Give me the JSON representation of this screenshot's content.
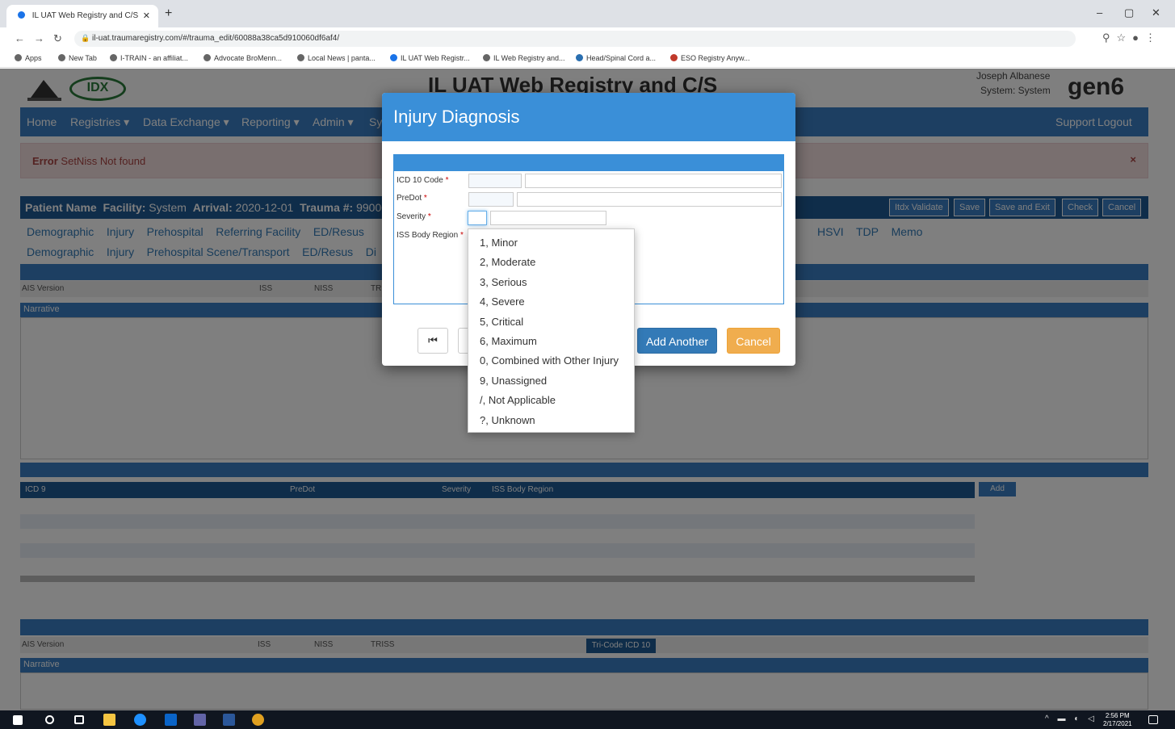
{
  "browser": {
    "tab_title": "IL UAT Web Registry and C/S",
    "url": "il-uat.traumaregistry.com/#/trauma_edit/60088a38ca5d910060df6af4/",
    "bookmarks": [
      "Apps",
      "New Tab",
      "I-TRAIN - an affiliat...",
      "Advocate BroMenn...",
      "Local News | panta...",
      "IL UAT Web Registr...",
      "IL Web Registry and...",
      "Head/Spinal Cord a...",
      "ESO Registry Anyw..."
    ]
  },
  "app": {
    "title": "IL UAT Web Registry and C/S",
    "user_name": "Joseph Albanese",
    "user_system": "System: System",
    "brand": "gen6",
    "logo_text": "IDX",
    "nav": [
      "Home",
      "Registries ▾",
      "Data Exchange ▾",
      "Reporting ▾",
      "Admin ▾",
      "Sy"
    ],
    "nav_right": [
      "Support",
      "Logout"
    ],
    "error_label": "Error",
    "error_text": "SetNiss Not found",
    "error_close": "×",
    "patient_bar": {
      "name_label": "Patient Name",
      "facility_label": "Facility:",
      "facility_value": "System",
      "arrival_label": "Arrival:",
      "arrival_value": "2020-12-01",
      "trauma_label": "Trauma #:",
      "trauma_value": "99000"
    },
    "toolbar_buttons": [
      "Itdx Validate",
      "Save",
      "Save and Exit",
      "Check",
      "Cancel"
    ],
    "link_row1": [
      "Demographic",
      "Injury",
      "Prehospital",
      "Referring Facility",
      "ED/Resus"
    ],
    "link_row1_right": [
      "HSVI",
      "TDP",
      "Memo"
    ],
    "link_row2": [
      "Demographic",
      "Injury",
      "Prehospital Scene/Transport",
      "ED/Resus",
      "Di"
    ],
    "ais_fields": [
      "AIS Version",
      "ISS",
      "NISS",
      "TR"
    ],
    "narrative_label": "Narrative",
    "grid_headers": [
      "ICD 9",
      "PreDot",
      "Severity",
      "ISS Body Region"
    ],
    "grid_add": "Add",
    "ais_fields2": [
      "AIS Version",
      "ISS",
      "NISS",
      "TRISS"
    ],
    "tri_code_button": "Tri-Code ICD 10",
    "narrative_label2": "Narrative"
  },
  "modal": {
    "title": "Injury Diagnosis",
    "fields": [
      {
        "label": "ICD 10 Code",
        "required": "*"
      },
      {
        "label": "PreDot",
        "required": "*"
      },
      {
        "label": "Severity",
        "required": "*"
      },
      {
        "label": "ISS Body Region",
        "required": "*"
      }
    ],
    "first_button": "⏮",
    "add_another": "Add Another",
    "cancel": "Cancel"
  },
  "severity_options": [
    "1, Minor",
    "2, Moderate",
    "3, Serious",
    "4, Severe",
    "5, Critical",
    "6, Maximum",
    "0, Combined with Other Injury",
    "9, Unassigned",
    "/, Not Applicable",
    "?, Unknown"
  ],
  "taskbar": {
    "time": "2:56 PM",
    "date": "2/17/2021"
  },
  "colors": {
    "primary": "#3a7fc4",
    "dark_primary": "#1f5a94",
    "modal_header": "#3a8fd8",
    "warning": "#f0ad4e",
    "error_bg": "#f2dede"
  }
}
